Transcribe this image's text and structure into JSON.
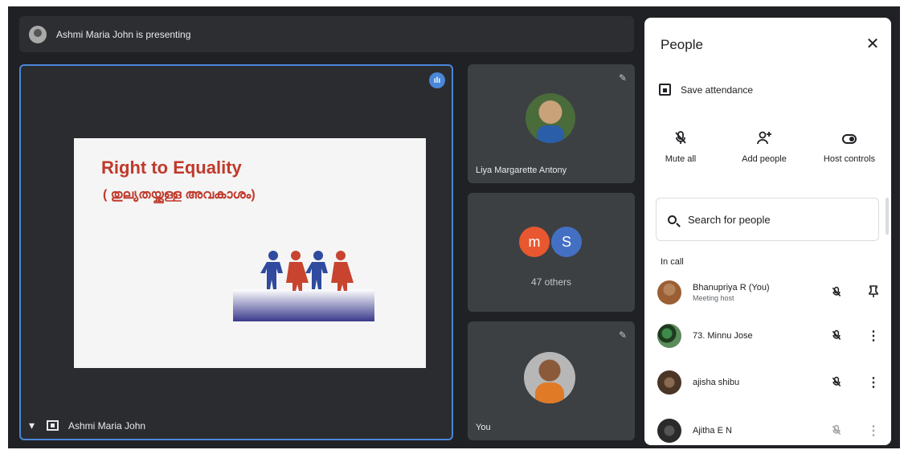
{
  "topbar": {
    "presenting_text": "Ashmi Maria John is presenting"
  },
  "main_tile": {
    "name": "Ashmi Maria John",
    "slide": {
      "title": "Right to Equality",
      "subtitle": "( തുല്യതയ്ക്കുള്ള അവകാശം)"
    }
  },
  "side_tiles": {
    "liya": {
      "name": "Liya Margarette Antony"
    },
    "others": {
      "avatar_letters": [
        "m",
        "S"
      ],
      "label": "47 others",
      "colors": [
        "#e8572f",
        "#4470c4"
      ]
    },
    "you": {
      "name": "You"
    }
  },
  "panel": {
    "title": "People",
    "close_icon": "close-icon",
    "save_attendance": "Save attendance",
    "actions": {
      "mute_all": "Mute all",
      "add_people": "Add people",
      "host_controls": "Host controls"
    },
    "search": {
      "placeholder": "Search for people"
    },
    "section_label": "In call",
    "people": [
      {
        "name": "Bhanupriya R (You)",
        "role": "Meeting host"
      },
      {
        "name": "73. Minnu Jose"
      },
      {
        "name": "ajisha shibu"
      },
      {
        "name": "Ajitha E N"
      }
    ]
  },
  "colors": {
    "accent": "#4a86d8",
    "dark_bg": "#202124",
    "tile_bg": "#3c4043"
  }
}
